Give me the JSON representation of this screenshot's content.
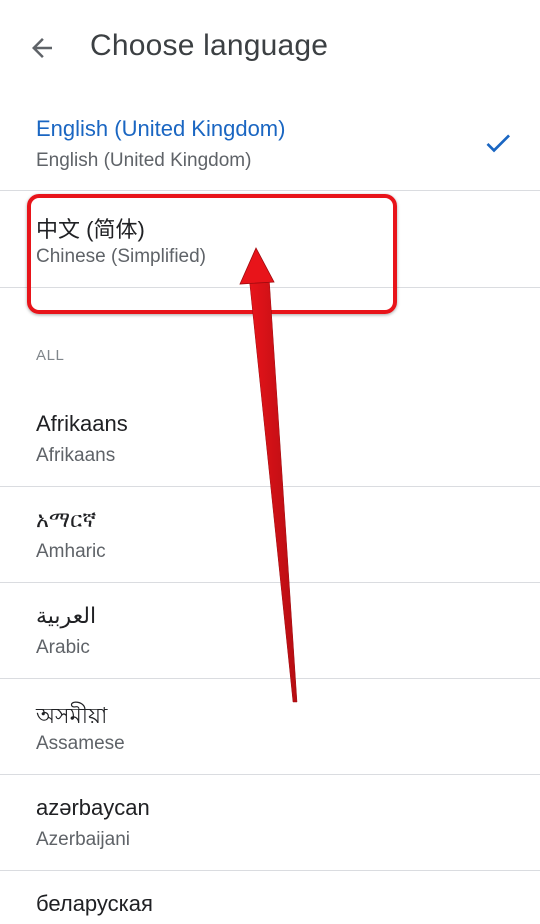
{
  "header": {
    "title": "Choose language",
    "back_icon": "arrow-left-icon"
  },
  "selected_language": {
    "native": "English (United Kingdom)",
    "english": "English (United Kingdom)",
    "check_icon": "checkmark-icon",
    "accent_color": "#1a66c2"
  },
  "suggested_language": {
    "native": "中文 (简体)",
    "english": "Chinese (Simplified)"
  },
  "section": {
    "label": "ALL"
  },
  "languages": [
    {
      "native": "Afrikaans",
      "english": "Afrikaans"
    },
    {
      "native": "አማርኛ",
      "english": "Amharic"
    },
    {
      "native": "العربية",
      "english": "Arabic"
    },
    {
      "native": "অসমীয়া",
      "english": "Assamese"
    },
    {
      "native": "azərbaycan",
      "english": "Azerbaijani"
    },
    {
      "native": "беларуская",
      "english": ""
    }
  ],
  "annotation": {
    "highlight_color": "#e8141a",
    "arrow_color": "#e8141a"
  }
}
